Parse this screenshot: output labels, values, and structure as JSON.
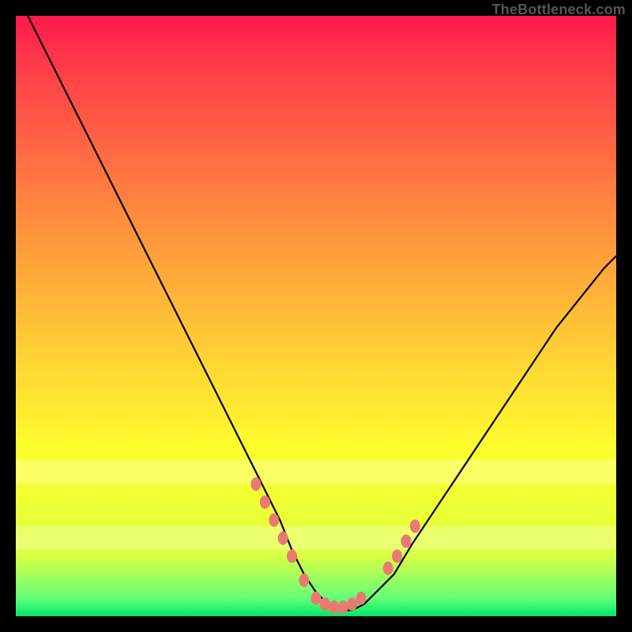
{
  "watermark": "TheBottleneck.com",
  "colors": {
    "frame": "#000000",
    "curve_stroke": "#000000",
    "marker_fill": "#e97a72",
    "gradient_top": "#ff1a4d",
    "gradient_mid": "#fff030",
    "gradient_bottom": "#00e868"
  },
  "chart_data": {
    "type": "line",
    "title": "",
    "xlabel": "",
    "ylabel": "",
    "xlim": [
      0,
      100
    ],
    "ylim": [
      0,
      100
    ],
    "series": [
      {
        "name": "bottleneck-curve",
        "x": [
          2,
          5,
          8,
          11,
          14,
          17,
          20,
          23,
          26,
          29,
          32,
          35,
          38,
          41,
          44,
          46,
          48,
          50,
          52,
          54,
          56,
          58,
          60,
          63,
          66,
          70,
          74,
          78,
          82,
          86,
          90,
          94,
          98,
          100
        ],
        "y": [
          100,
          94,
          88,
          82,
          76,
          70,
          64,
          58,
          52,
          46,
          40,
          34,
          28,
          22,
          16,
          11,
          7,
          4,
          2,
          1,
          1,
          2,
          4,
          7,
          12,
          18,
          24,
          30,
          36,
          42,
          48,
          53,
          58,
          60
        ]
      }
    ],
    "markers": {
      "name": "highlight-points",
      "x": [
        40,
        41.5,
        43,
        44.5,
        46,
        48,
        50,
        51.5,
        53,
        54.5,
        56,
        57.5,
        62,
        63.5,
        65,
        66.5
      ],
      "y": [
        22,
        19,
        16,
        13,
        10,
        6,
        3,
        2,
        1.5,
        1.5,
        2,
        3,
        8,
        10,
        12.5,
        15
      ]
    },
    "pale_bands": [
      {
        "y_from": 22,
        "y_to": 26
      },
      {
        "y_from": 11,
        "y_to": 15
      }
    ]
  }
}
